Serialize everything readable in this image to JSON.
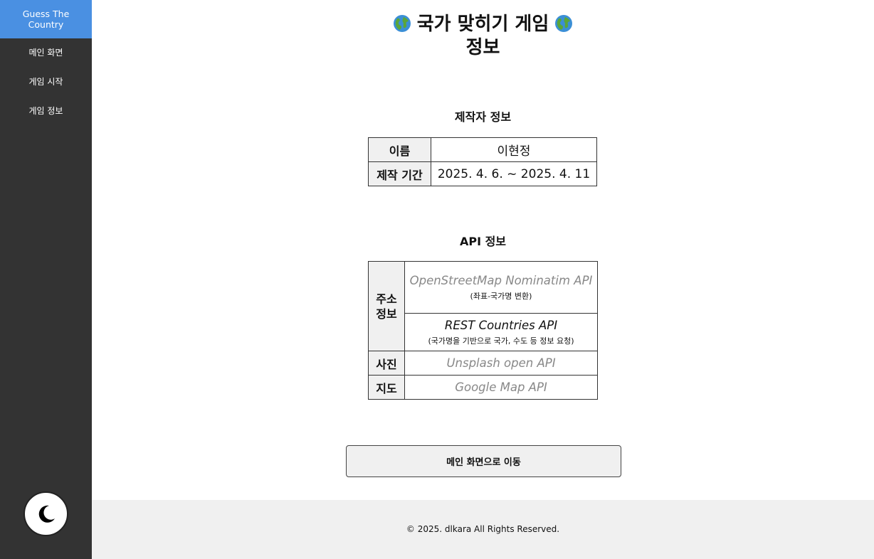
{
  "sidebar": {
    "brand": "Guess The Country",
    "items": [
      {
        "label": "메인 화면"
      },
      {
        "label": "게임 시작"
      },
      {
        "label": "게임 정보"
      }
    ],
    "theme_icon": "moon-icon"
  },
  "page": {
    "title_line1": "국가 맞히기 게임",
    "title_line2": "정보",
    "title_icon": "globe-icon"
  },
  "maker": {
    "title": "제작자 정보",
    "rows": [
      {
        "label": "이름",
        "value": "이현정"
      },
      {
        "label": "제작 기간",
        "value": "2025. 4. 6. ~ 2025. 4. 11"
      }
    ]
  },
  "api": {
    "title": "API 정보",
    "address_label": "주소 정보",
    "address_apis": [
      {
        "name": "OpenStreetMap Nominatim API",
        "note": "(좌표-국가명 변환)"
      },
      {
        "name": "REST Countries API",
        "note": "(국가명을 기반으로 국가, 수도 등 정보 요청)"
      }
    ],
    "photo_label": "사진",
    "photo_api": "Unsplash open API",
    "map_label": "지도",
    "map_api": "Google Map API"
  },
  "button": {
    "label": "메인 화면으로 이동"
  },
  "footer": {
    "text": "© 2025. dlkara All Rights Reserved."
  },
  "colors": {
    "sidebar_bg": "#333333",
    "brand_bg": "#4a90e2",
    "footer_bg": "#f0f0f0"
  }
}
